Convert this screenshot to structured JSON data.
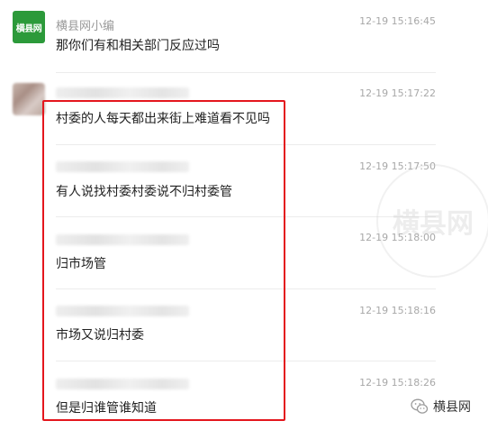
{
  "messages": [
    {
      "sender": "横县网小编",
      "time": "12-19 15:16:45",
      "text": "那你们有和相关部门反应过吗",
      "avatar_label": "横县网"
    },
    {
      "sender": "",
      "time": "12-19 15:17:22",
      "text": "村委的人每天都出来街上难道看不见吗"
    },
    {
      "sender": "",
      "time": "12-19 15:17:50",
      "text": "有人说找村委村委说不归村委管"
    },
    {
      "sender": "",
      "time": "12-19 15:18:00",
      "text": "归市场管"
    },
    {
      "sender": "",
      "time": "12-19 15:18:16",
      "text": "市场又说归村委"
    },
    {
      "sender": "",
      "time": "12-19 15:18:26",
      "text": "但是归谁管谁知道"
    }
  ],
  "watermark": {
    "text": "横县网"
  },
  "brand": {
    "name": "横县网",
    "icon": "wechat-icon"
  },
  "colors": {
    "highlight": "#e4161d",
    "avatar_green": "#2c9a3a"
  }
}
